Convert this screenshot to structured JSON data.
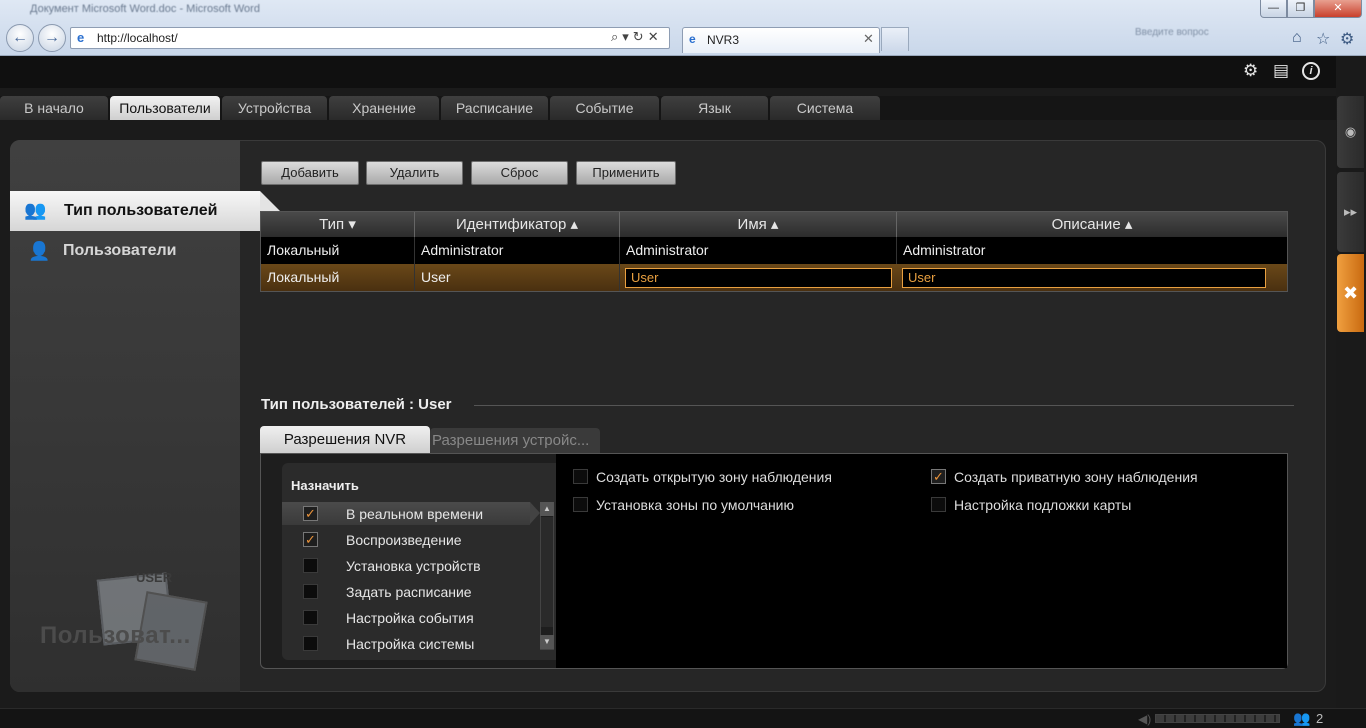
{
  "browser": {
    "window_title": "Документ Microsoft Word.doc - Microsoft Word",
    "url": "http://localhost/",
    "tab_label": "NVR3",
    "right_hint": "Введите вопрос",
    "minimize": "—",
    "maximize": "❐",
    "close": "✕"
  },
  "main_tabs": [
    "В начало",
    "Пользователи",
    "Устройства",
    "Хранение",
    "Расписание",
    "Событие",
    "Язык",
    "Система"
  ],
  "left_nav": {
    "user_types": "Тип пользователей",
    "users": "Пользователи",
    "bg_caption": "Пользоват..."
  },
  "actions": {
    "add": "Добавить",
    "delete": "Удалить",
    "reset": "Сброс",
    "apply": "Применить"
  },
  "table": {
    "headers": [
      "Тип ▾",
      "Идентификатор ▴",
      "Имя ▴",
      "Описание ▴"
    ],
    "rows": [
      [
        "Локальный",
        "Administrator",
        "Administrator",
        "Administrator"
      ],
      [
        "Локальный",
        "User",
        "User",
        "User"
      ]
    ]
  },
  "section": {
    "title": "Тип пользователей : User"
  },
  "perm_tabs": {
    "nvr": "Разрешения NVR",
    "devices": "Разрешения устройс..."
  },
  "assign": {
    "title": "Назначить",
    "items": [
      {
        "label": "В реальном времени",
        "checked": true
      },
      {
        "label": "Воспроизведение",
        "checked": true
      },
      {
        "label": "Установка устройств",
        "checked": false
      },
      {
        "label": "Задать расписание",
        "checked": false
      },
      {
        "label": "Настройка события",
        "checked": false
      },
      {
        "label": "Настройка системы",
        "checked": false
      }
    ]
  },
  "permissions": [
    {
      "label": "Создать открытую зону наблюдения",
      "checked": false
    },
    {
      "label": "Создать приватную зону наблюдения",
      "checked": true
    },
    {
      "label": "Установка зоны по умолчанию",
      "checked": false
    },
    {
      "label": "Настройка подложки карты",
      "checked": false
    }
  ],
  "footer": {
    "user_count": "2"
  },
  "colors": {
    "accent": "#e9923a",
    "selected_row": "#5a3c14"
  }
}
